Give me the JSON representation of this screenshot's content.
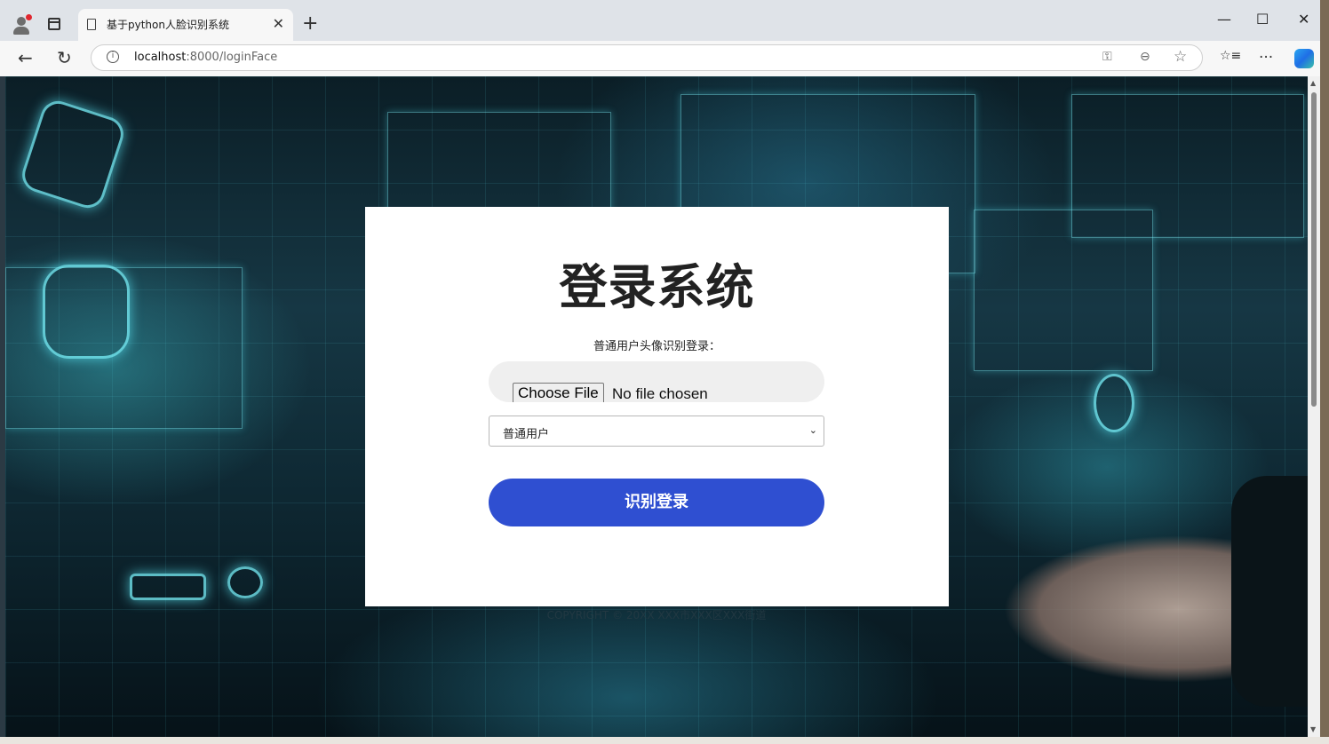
{
  "browser": {
    "tab_title": "基于python人脸识别系统",
    "url_host": "localhost",
    "url_rest": ":8000/loginFace",
    "controls": {
      "minimize": "—",
      "maximize": "☐",
      "close": "✕",
      "new_tab": "+",
      "tab_close": "✕",
      "back": "←",
      "reload": "↻",
      "key": "⚿",
      "zoom": "⊖",
      "favorite": "☆",
      "favorites_list": "☆≡",
      "more": "···"
    }
  },
  "page": {
    "heading": "登录系统",
    "subtitle": "普通用户头像识别登录：",
    "file_button": "Choose File",
    "file_status": "No file chosen",
    "role_select": {
      "selected": "普通用户"
    },
    "submit_label": "识别登录",
    "footer": "COPYRIGHT © 20XX XXX市XXX区XXX街道",
    "accent_color": "#2f4fd1"
  }
}
